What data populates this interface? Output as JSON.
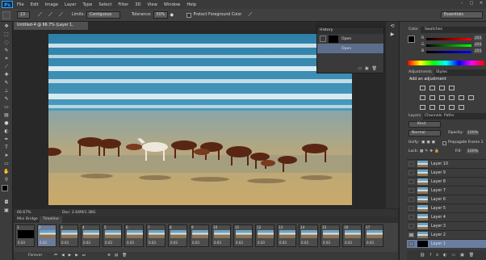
{
  "app": {
    "logo": "Ps"
  },
  "menu": [
    "File",
    "Edit",
    "Image",
    "Layer",
    "Type",
    "Select",
    "Filter",
    "3D",
    "View",
    "Window",
    "Help"
  ],
  "options": {
    "brush_size": "13",
    "limits_label": "Limits:",
    "limits_value": "Contiguous",
    "tolerance_label": "Tolerance:",
    "tolerance_value": "50%",
    "protect_label": "Protect Foreground Color",
    "workspace": "Essentials"
  },
  "document": {
    "tab": "Untitled-4 @ 66.7% (Layer 1, RGB/8) *",
    "zoom": "66.67%",
    "doc_info": "Doc: 2.64M/1.38G"
  },
  "history": {
    "title": "History",
    "rows": [
      "Open",
      "Open"
    ]
  },
  "color_panel": {
    "tabs": [
      "Color",
      "Swatches"
    ],
    "channels": [
      "R",
      "G",
      "B"
    ],
    "values": [
      "255",
      "255",
      "255"
    ]
  },
  "adjustments": {
    "tabs": [
      "Adjustments",
      "Styles"
    ],
    "title": "Add an adjustment"
  },
  "layers": {
    "tabs": [
      "Layers",
      "Channels",
      "Paths"
    ],
    "kind": "Kind",
    "blend": "Normal",
    "opacity_label": "Opacity:",
    "opacity": "100%",
    "unify_label": "Unify:",
    "propagate": "Propagate Frame 1",
    "lock_label": "Lock:",
    "fill_label": "Fill:",
    "fill": "100%",
    "items": [
      "Layer 10",
      "Layer 9",
      "Layer 8",
      "Layer 7",
      "Layer 6",
      "Layer 5",
      "Layer 4",
      "Layer 3",
      "Layer 2",
      "Layer 1"
    ]
  },
  "timeline": {
    "tabs": [
      "Mini Bridge",
      "Timeline"
    ],
    "frames": [
      "1",
      "2",
      "3",
      "4",
      "5",
      "6",
      "7",
      "8",
      "9",
      "10",
      "11",
      "12",
      "13",
      "14",
      "15",
      "16",
      "17"
    ],
    "delay": "0.03",
    "loop": "Forever"
  }
}
